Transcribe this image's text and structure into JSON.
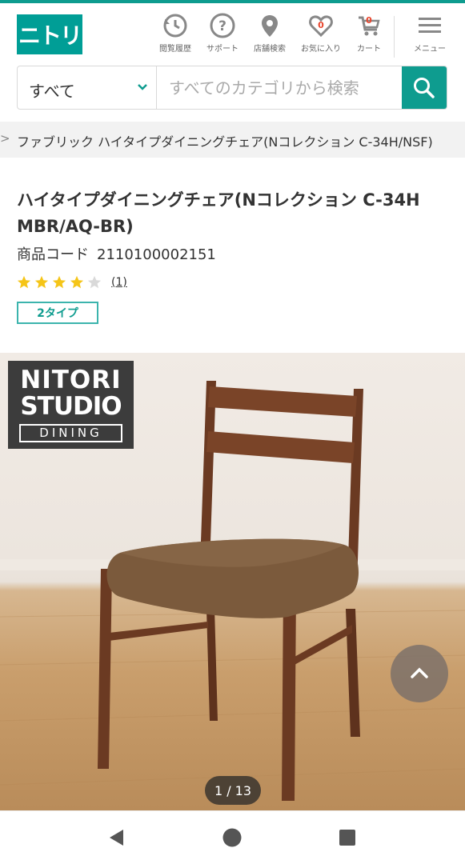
{
  "header": {
    "logo_text": "ニトリ",
    "icons": [
      {
        "name": "history-icon",
        "label": "閲覧履歴"
      },
      {
        "name": "support-icon",
        "label": "サポート"
      },
      {
        "name": "store-search-icon",
        "label": "店舗検索"
      },
      {
        "name": "favorite-icon",
        "label": "お気に入り",
        "badge": "0"
      },
      {
        "name": "cart-icon",
        "label": "カート",
        "badge": "0"
      },
      {
        "name": "menu-icon",
        "label": "メニュー"
      }
    ]
  },
  "search": {
    "category": "すべて",
    "placeholder": "すべてのカテゴリから検索"
  },
  "breadcrumb": {
    "separator": ">",
    "text": "ファブリック ハイタイプダイニングチェア(Nコレクション C-34H/NSF)"
  },
  "product": {
    "title": "ハイタイプダイニングチェア(Nコレクション C-34H MBR/AQ-BR)",
    "code_label": "商品コード",
    "code_value": "2110100002151",
    "rating": 4,
    "rating_max": 5,
    "review_count": "(1)",
    "types_label": "2タイプ"
  },
  "gallery": {
    "brand_line1": "NITORI",
    "brand_line2": "STUDIO",
    "brand_line3": "DINING",
    "counter": "1 / 13"
  },
  "colors": {
    "brand": "#009e96",
    "accent": "#0e9c8f",
    "star_on": "#f5c518",
    "star_off": "#d9d9d9"
  }
}
